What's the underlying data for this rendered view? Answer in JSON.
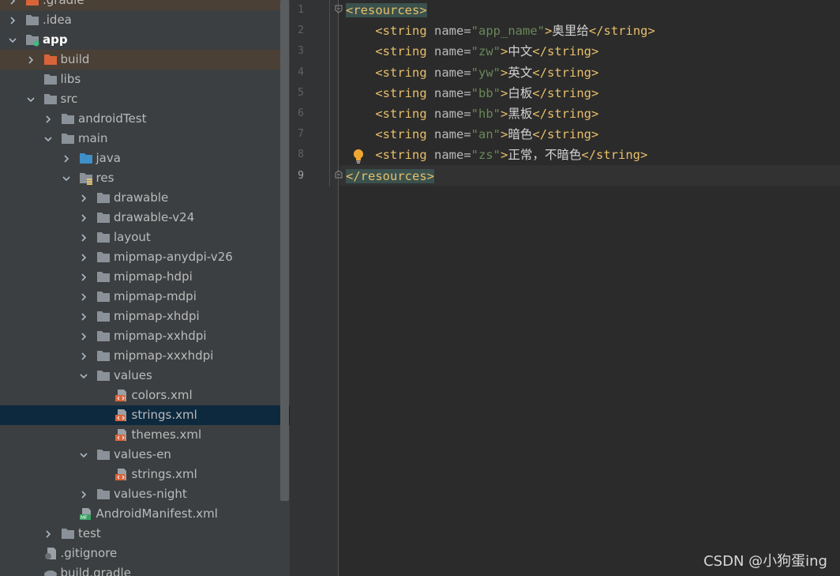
{
  "project_tree": {
    "items": [
      {
        "label": ".gradle",
        "indent": 0,
        "arrow": "right",
        "icon": "folder-orange",
        "style": "hl"
      },
      {
        "label": ".idea",
        "indent": 0,
        "arrow": "right",
        "icon": "folder",
        "style": ""
      },
      {
        "label": "app",
        "indent": 0,
        "arrow": "down",
        "icon": "module-folder",
        "style": "bold"
      },
      {
        "label": "build",
        "indent": 1,
        "arrow": "right",
        "icon": "folder-orange",
        "style": "hl"
      },
      {
        "label": "libs",
        "indent": 1,
        "arrow": "",
        "icon": "folder",
        "style": ""
      },
      {
        "label": "src",
        "indent": 1,
        "arrow": "down",
        "icon": "folder",
        "style": ""
      },
      {
        "label": "androidTest",
        "indent": 2,
        "arrow": "right",
        "icon": "folder",
        "style": ""
      },
      {
        "label": "main",
        "indent": 2,
        "arrow": "down",
        "icon": "folder",
        "style": ""
      },
      {
        "label": "java",
        "indent": 3,
        "arrow": "right",
        "icon": "folder-blue",
        "style": ""
      },
      {
        "label": "res",
        "indent": 3,
        "arrow": "down",
        "icon": "res-folder",
        "style": ""
      },
      {
        "label": "drawable",
        "indent": 4,
        "arrow": "right",
        "icon": "folder",
        "style": ""
      },
      {
        "label": "drawable-v24",
        "indent": 4,
        "arrow": "right",
        "icon": "folder",
        "style": ""
      },
      {
        "label": "layout",
        "indent": 4,
        "arrow": "right",
        "icon": "folder",
        "style": ""
      },
      {
        "label": "mipmap-anydpi-v26",
        "indent": 4,
        "arrow": "right",
        "icon": "folder",
        "style": ""
      },
      {
        "label": "mipmap-hdpi",
        "indent": 4,
        "arrow": "right",
        "icon": "folder",
        "style": ""
      },
      {
        "label": "mipmap-mdpi",
        "indent": 4,
        "arrow": "right",
        "icon": "folder",
        "style": ""
      },
      {
        "label": "mipmap-xhdpi",
        "indent": 4,
        "arrow": "right",
        "icon": "folder",
        "style": ""
      },
      {
        "label": "mipmap-xxhdpi",
        "indent": 4,
        "arrow": "right",
        "icon": "folder",
        "style": ""
      },
      {
        "label": "mipmap-xxxhdpi",
        "indent": 4,
        "arrow": "right",
        "icon": "folder",
        "style": ""
      },
      {
        "label": "values",
        "indent": 4,
        "arrow": "down",
        "icon": "folder",
        "style": ""
      },
      {
        "label": "colors.xml",
        "indent": 5,
        "arrow": "",
        "icon": "xml-file",
        "style": ""
      },
      {
        "label": "strings.xml",
        "indent": 5,
        "arrow": "",
        "icon": "xml-file",
        "style": "sel"
      },
      {
        "label": "themes.xml",
        "indent": 5,
        "arrow": "",
        "icon": "xml-file",
        "style": ""
      },
      {
        "label": "values-en",
        "indent": 4,
        "arrow": "down",
        "icon": "folder",
        "style": ""
      },
      {
        "label": "strings.xml",
        "indent": 5,
        "arrow": "",
        "icon": "xml-file",
        "style": ""
      },
      {
        "label": "values-night",
        "indent": 4,
        "arrow": "right",
        "icon": "folder",
        "style": ""
      },
      {
        "label": "AndroidManifest.xml",
        "indent": 3,
        "arrow": "",
        "icon": "manifest-file",
        "style": ""
      },
      {
        "label": "test",
        "indent": 2,
        "arrow": "right",
        "icon": "folder",
        "style": ""
      },
      {
        "label": ".gitignore",
        "indent": 1,
        "arrow": "",
        "icon": "gitignore-file",
        "style": ""
      },
      {
        "label": "build.gradle",
        "indent": 1,
        "arrow": "",
        "icon": "gradle-file",
        "style": ""
      }
    ]
  },
  "editor": {
    "line_numbers": [
      "1",
      "2",
      "3",
      "4",
      "5",
      "6",
      "7",
      "8",
      "9"
    ],
    "current_line": 9,
    "open_tag": "<resources>",
    "close_tag": "</resources>",
    "string_open": "<string",
    "attr_name": "name",
    "string_close": "</string>",
    "strings": [
      {
        "name": "\"app_name\"",
        "value": "奥里给"
      },
      {
        "name": "\"zw\"",
        "value": "中文"
      },
      {
        "name": "\"yw\"",
        "value": "英文"
      },
      {
        "name": "\"bb\"",
        "value": "白板"
      },
      {
        "name": "\"hb\"",
        "value": "黑板"
      },
      {
        "name": "\"an\"",
        "value": "暗色"
      },
      {
        "name": "\"zs\"",
        "value": "正常，不暗色"
      }
    ]
  },
  "colors": {
    "tree_bg": "#3c3f41",
    "editor_bg": "#2b2b2b",
    "tag": "#e8bf6a",
    "attr_value": "#6a8759",
    "selection": "#0d293e"
  },
  "watermark": "CSDN @小狗蛋ing"
}
